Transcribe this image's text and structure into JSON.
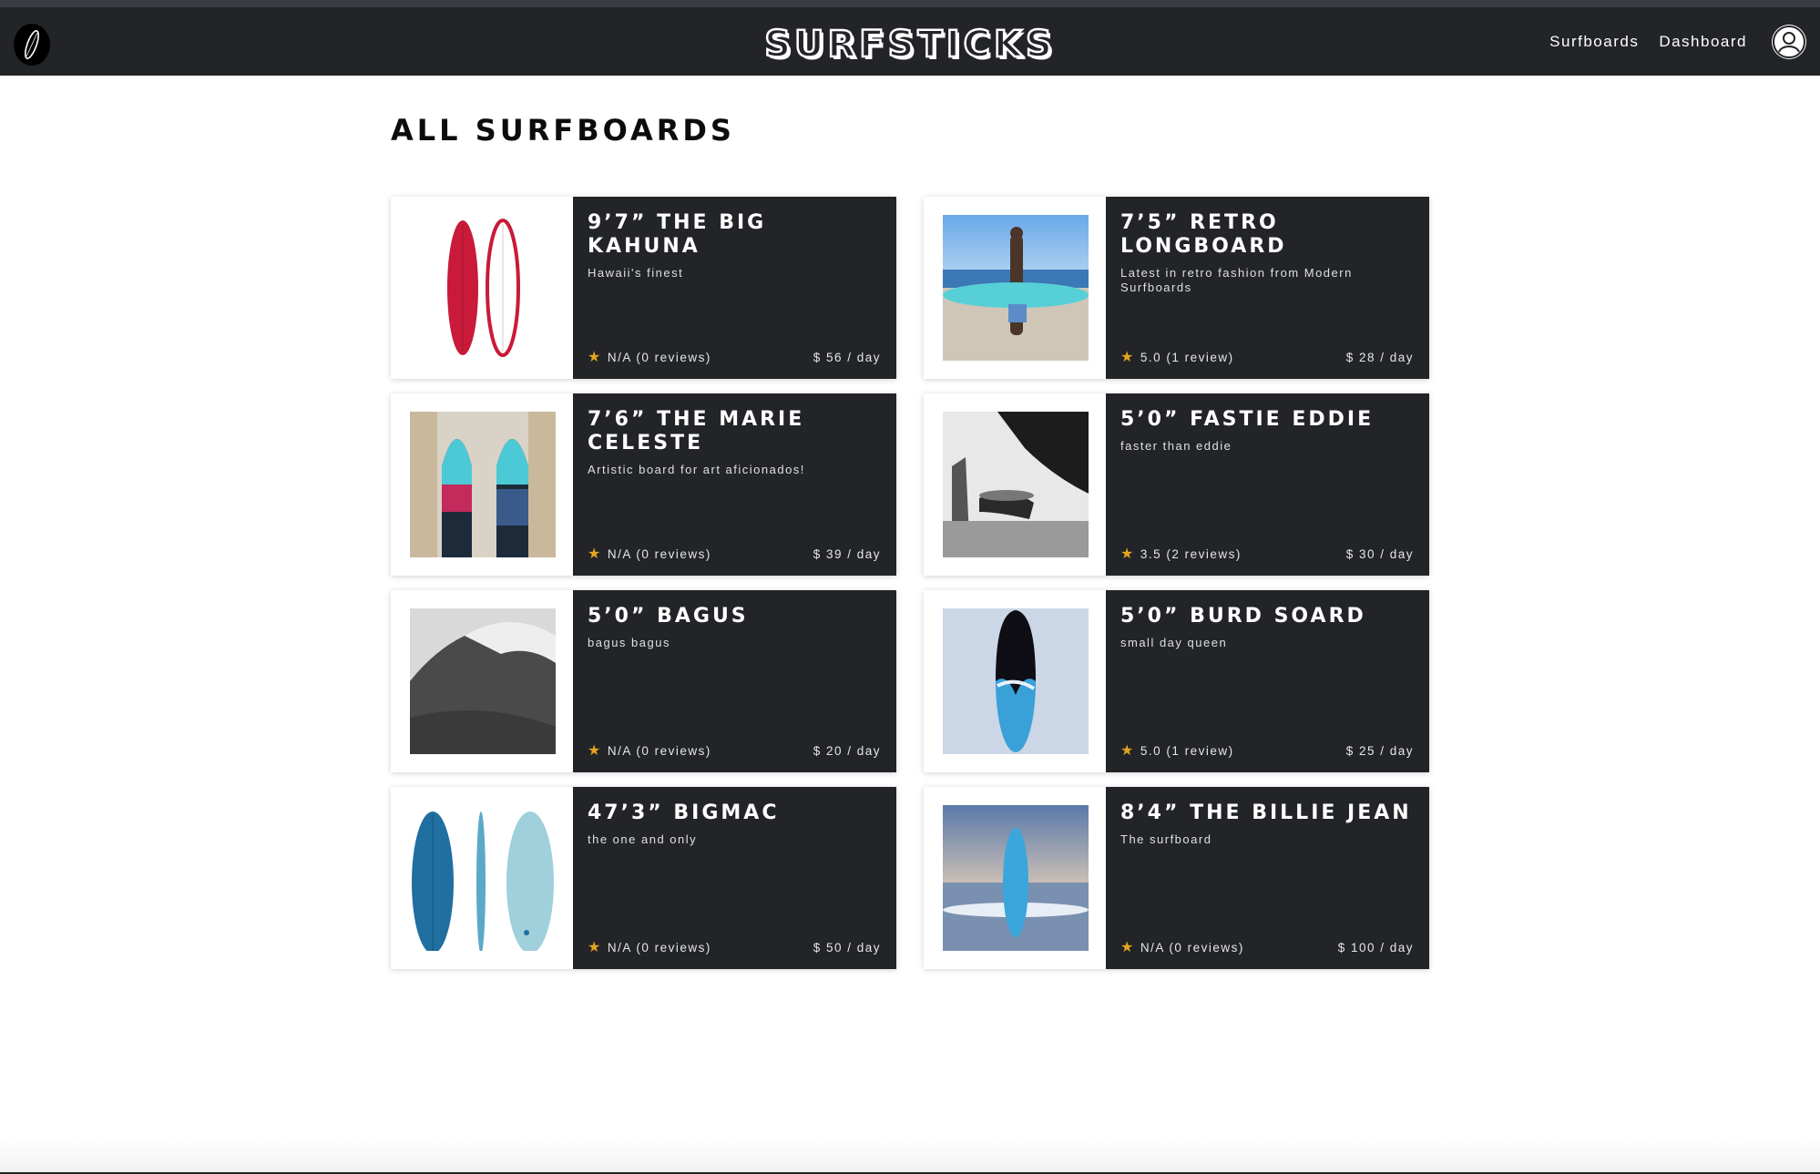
{
  "header": {
    "brand": "SURFSTICKS",
    "nav": [
      {
        "label": "Surfboards"
      },
      {
        "label": "Dashboard"
      }
    ]
  },
  "page": {
    "title": "ALL SURFBOARDS"
  },
  "colors": {
    "navbar": "#222428",
    "card_info": "#222428",
    "star": "#e2a420"
  },
  "boards": [
    {
      "title": "9’7” The Big Kahuna",
      "description": "Hawaii's finest",
      "rating": "N/A (0 reviews)",
      "price": "$ 56 / day",
      "image": "red-surfboards-image"
    },
    {
      "title": "7’5” Retro Longboard",
      "description": "Latest in retro fashion from Modern Surfboards",
      "rating": "5.0 (1 review)",
      "price": "$ 28 / day",
      "image": "man-holding-longboard-image"
    },
    {
      "title": "7’6” The Marie Celeste",
      "description": "Artistic board for art aficionados!",
      "rating": "N/A (0 reviews)",
      "price": "$ 39 / day",
      "image": "painted-boards-image"
    },
    {
      "title": "5’0” Fastie Eddie",
      "description": "faster than eddie",
      "rating": "3.5 (2 reviews)",
      "price": "$ 30 / day",
      "image": "skater-bw-image"
    },
    {
      "title": "5’0” Bagus",
      "description": "bagus bagus",
      "rating": "N/A (0 reviews)",
      "price": "$ 20 / day",
      "image": "big-wave-image"
    },
    {
      "title": "5’0” Burd Soard",
      "description": "small day queen",
      "rating": "5.0 (1 review)",
      "price": "$ 25 / day",
      "image": "blue-black-board-image"
    },
    {
      "title": "47’3” BigMac",
      "description": "the one and only",
      "rating": "N/A (0 reviews)",
      "price": "$ 50 / day",
      "image": "blue-boards-image"
    },
    {
      "title": "8’4” The Billie Jean",
      "description": "The surfboard",
      "rating": "N/A (0 reviews)",
      "price": "$ 100 / day",
      "image": "board-on-beach-image"
    }
  ]
}
